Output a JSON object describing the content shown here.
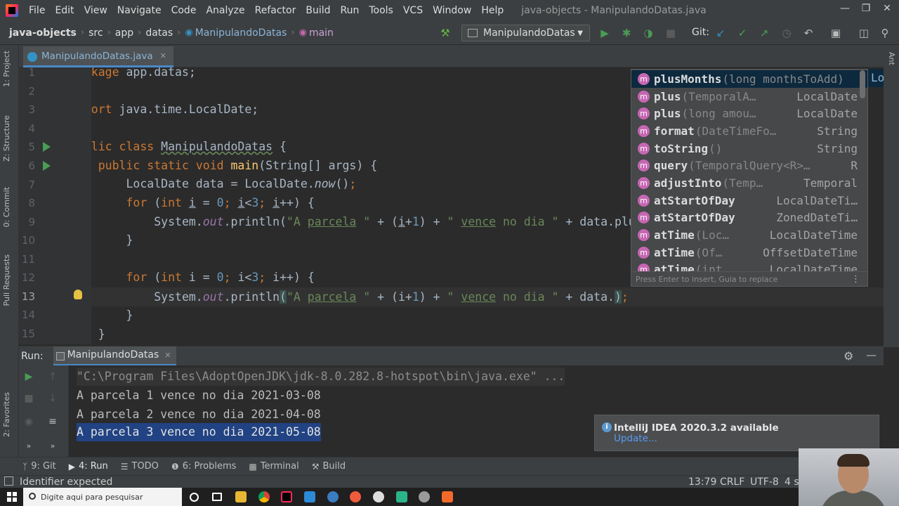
{
  "window": {
    "title": "java-objects - ManipulandoDatas.java",
    "menu": [
      "File",
      "Edit",
      "View",
      "Navigate",
      "Code",
      "Analyze",
      "Refactor",
      "Build",
      "Run",
      "Tools",
      "VCS",
      "Window",
      "Help"
    ]
  },
  "breadcrumb": {
    "project": "java-objects",
    "items": [
      "src",
      "app",
      "datas"
    ],
    "class": "ManipulandoDatas",
    "method": "main"
  },
  "toolbar": {
    "run_config": "ManipulandoDatas",
    "git_label": "Git:"
  },
  "left_tabs": [
    "1: Project",
    "Z: Structure",
    "0: Commit",
    "Pull Requests",
    "2: Favorites"
  ],
  "right_tabs": [
    "Ant"
  ],
  "editor": {
    "tab_label": "ManipulandoDatas.java",
    "line_numbers": [
      "1",
      "2",
      "3",
      "4",
      "5",
      "6",
      "7",
      "8",
      "9",
      "10",
      "11",
      "12",
      "13",
      "14",
      "15"
    ],
    "current_line": "13"
  },
  "completion": {
    "items": [
      {
        "name": "plusMonths",
        "sig": "(long monthsToAdd)",
        "type": ""
      },
      {
        "name": "plus",
        "sig": "(TemporalA…",
        "type": "LocalDate"
      },
      {
        "name": "plus",
        "sig": "(long amou…",
        "type": "LocalDate"
      },
      {
        "name": "format",
        "sig": "(DateTimeFo…",
        "type": "String"
      },
      {
        "name": "toString",
        "sig": "()",
        "type": "String"
      },
      {
        "name": "query",
        "sig": "(TemporalQuery<R>…",
        "type": "R"
      },
      {
        "name": "adjustInto",
        "sig": "(Temp…",
        "type": "Temporal"
      },
      {
        "name": "atStartOfDay",
        "sig": "",
        "type": "LocalDateTi…"
      },
      {
        "name": "atStartOfDay",
        "sig": "",
        "type": "ZonedDateTi…"
      },
      {
        "name": "atTime",
        "sig": "(Loc…",
        "type": "LocalDateTime"
      },
      {
        "name": "atTime",
        "sig": "(Of…",
        "type": "OffsetDateTime"
      },
      {
        "name": "atTime",
        "sig": "(int…",
        "type": "LocalDateTime"
      }
    ],
    "hint": "Press Enter to insert, Guia to replace",
    "tail_text": "Lo"
  },
  "run": {
    "label": "Run:",
    "tab_label": "ManipulandoDatas",
    "console": [
      "\"C:\\Program Files\\AdoptOpenJDK\\jdk-8.0.282.8-hotspot\\bin\\java.exe\" ...",
      "A parcela 1 vence no dia 2021-03-08",
      "A parcela 2 vence no dia 2021-04-08",
      "A parcela 3 vence no dia 2021-05-08"
    ]
  },
  "notification": {
    "title": "IntelliJ IDEA 2020.3.2 available",
    "link": "Update..."
  },
  "tool_tabs": [
    {
      "label": "9: Git",
      "icon": "git-branch-icon"
    },
    {
      "label": "4: Run",
      "icon": "run-icon"
    },
    {
      "label": "TODO",
      "icon": "list-icon"
    },
    {
      "label": "6: Problems",
      "icon": "info-icon"
    },
    {
      "label": "Terminal",
      "icon": "terminal-icon"
    },
    {
      "label": "Build",
      "icon": "hammer-icon"
    }
  ],
  "status": {
    "message": "Identifier expected",
    "position": "13:79",
    "line_sep": "CRLF",
    "encoding": "UTF-8",
    "indent": "4 s"
  },
  "taskbar": {
    "search_placeholder": "Digite aqui para pesquisar"
  },
  "colors": {
    "accent": "#4a88c7",
    "keyword": "#cc7832",
    "string": "#6a8759",
    "number": "#6897bb",
    "selection": "#214283"
  }
}
